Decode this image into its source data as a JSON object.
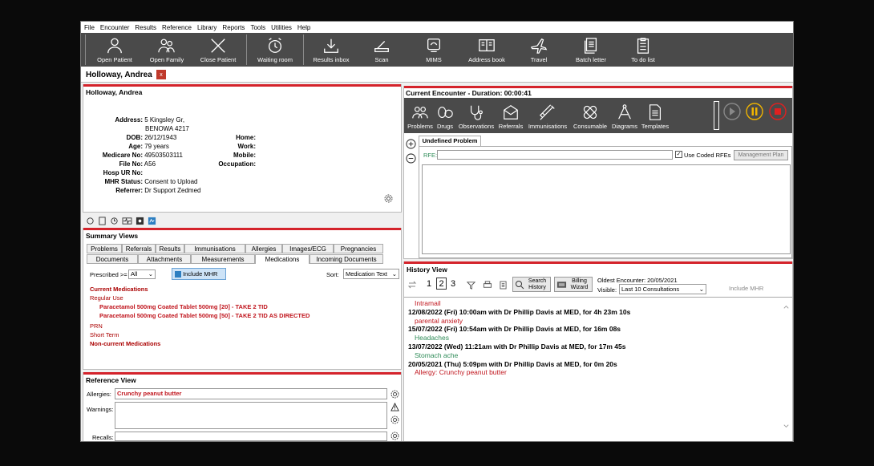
{
  "menu": [
    "File",
    "Encounter",
    "Results",
    "Reference",
    "Library",
    "Reports",
    "Tools",
    "Utilities",
    "Help"
  ],
  "toolbar": [
    {
      "label": "Open Patient",
      "icon": "person-icon"
    },
    {
      "label": "Open Family",
      "icon": "family-icon"
    },
    {
      "label": "Close Patient",
      "icon": "close-x-icon"
    },
    {
      "label": "Waiting room",
      "icon": "alarm-clock-icon"
    },
    {
      "label": "Results inbox",
      "icon": "download-tray-icon"
    },
    {
      "label": "Scan",
      "icon": "scanner-icon"
    },
    {
      "label": "MIMS",
      "icon": "mims-icon"
    },
    {
      "label": "Address book",
      "icon": "book-icon"
    },
    {
      "label": "Travel",
      "icon": "plane-icon"
    },
    {
      "label": "Batch letter",
      "icon": "documents-icon"
    },
    {
      "label": "To do list",
      "icon": "checklist-icon"
    }
  ],
  "patient_tab": {
    "name": "Holloway, Andrea",
    "close": "x"
  },
  "details": {
    "title": "Holloway, Andrea",
    "labels": {
      "address": "Address:",
      "dob": "DOB:",
      "age": "Age:",
      "medicare": "Medicare No:",
      "file": "File No:",
      "hosp": "Hosp UR No:",
      "mhr": "MHR Status:",
      "referrer": "Referrer:",
      "home": "Home:",
      "work": "Work:",
      "mobile": "Mobile:",
      "occupation": "Occupation:"
    },
    "address1": "5 Kingsley  Gr,",
    "address2": "BENOWA  4217",
    "dob": "26/12/1943",
    "age": "79 years",
    "medicare": "49503503111",
    "file": "A56",
    "mhr": "Consent to Upload",
    "referrer": "Dr Support Zedmed"
  },
  "summary": {
    "title": "Summary Views",
    "tabs_row1": [
      "Problems",
      "Referrals",
      "Results",
      "Immunisations",
      "Allergies",
      "Images/ECG",
      "Pregnancies"
    ],
    "tabs_row2": [
      "Documents",
      "Attachments",
      "Measurements",
      "Medications",
      "Incoming Documents"
    ],
    "prescribed_label": "Prescribed >=",
    "prescribed_value": "All",
    "include_mhr": "Include MHR",
    "sort_label": "Sort:",
    "sort_value": "Medication Text",
    "current": "Current Medications",
    "regular": "Regular Use",
    "med1": "Paracetamol 500mg Coated Tablet 500mg [20] - TAKE 2 TID",
    "med2": "Paracetamol 500mg Coated Tablet 500mg [50] - TAKE 2 TID AS DIRECTED",
    "prn": "PRN",
    "short": "Short Term",
    "noncurrent": "Non-current Medications"
  },
  "reference": {
    "title": "Reference View",
    "allergies_label": "Allergies:",
    "allergies_value": "Crunchy peanut butter",
    "warnings_label": "Warnings:",
    "recalls_label": "Recalls:"
  },
  "encounter": {
    "title": "Current Encounter - Duration: 00:00:41",
    "tools": [
      {
        "label": "Problems",
        "icon": "problems-icon"
      },
      {
        "label": "Drugs",
        "icon": "pills-icon"
      },
      {
        "label": "Observations",
        "icon": "stethoscope-icon"
      },
      {
        "label": "Referrals",
        "icon": "envelope-icon"
      },
      {
        "label": "Immunisations",
        "icon": "syringe-icon"
      },
      {
        "label": "Consumable",
        "icon": "bandage-icon"
      },
      {
        "label": "Diagrams",
        "icon": "compass-icon"
      },
      {
        "label": "Templates",
        "icon": "template-icon"
      }
    ],
    "problem_tab": "Undefined Problem",
    "rfe_label": "RFE:",
    "use_coded": "Use Coded RFEs",
    "management_plan": "Management Plan",
    "play_icon": "play-icon",
    "pause_icon": "pause-icon",
    "stop_icon": "stop-icon"
  },
  "history": {
    "title": "History View",
    "pages": [
      "1",
      "2",
      "3"
    ],
    "search_history": "Search History",
    "billing_wizard": "Billing Wizard",
    "oldest": "Oldest Encounter: 20/05/2021",
    "visible_label": "Visible:",
    "visible_value": "Last 10 Consultations",
    "include_mhr": "Include MHR",
    "entries": [
      {
        "text": "Intramail",
        "style": "red"
      },
      {
        "text": "12/08/2022 (Fri) 10:00am with Dr Phillip Davis at MED, for 4h 23m 10s",
        "style": "b"
      },
      {
        "text": "parental anxiety",
        "style": "red"
      },
      {
        "text": "15/07/2022 (Fri) 10:54am with Dr Phillip Davis at MED, for 16m 08s",
        "style": "b"
      },
      {
        "text": "Headaches",
        "style": "green"
      },
      {
        "text": "13/07/2022 (Wed) 11:21am with Dr Phillip Davis at MED, for 17m 45s",
        "style": "b"
      },
      {
        "text": "Stomach ache",
        "style": "green"
      },
      {
        "text": "20/05/2021 (Thu) 5:09pm with Dr Phillip Davis at MED, for 0m 20s",
        "style": "b"
      },
      {
        "text": "Allergy: Crunchy peanut butter",
        "style": "red"
      }
    ]
  }
}
